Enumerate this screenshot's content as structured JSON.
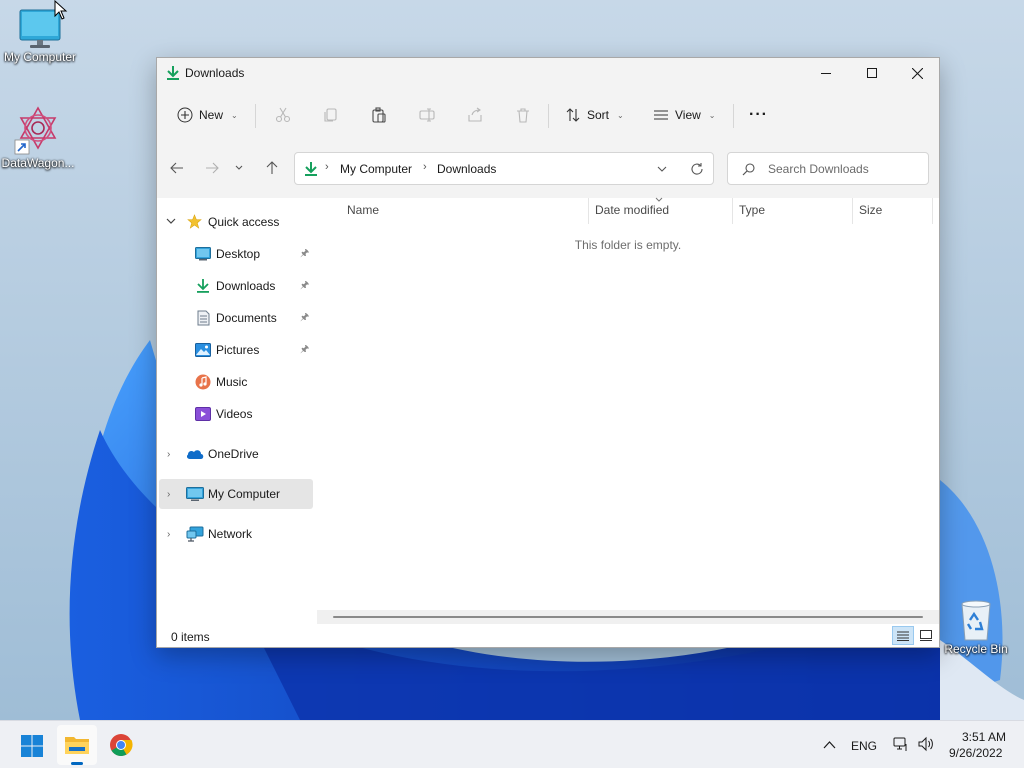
{
  "desktop": {
    "icons": [
      {
        "label": "My Computer",
        "icon": "monitor-icon"
      },
      {
        "label": "DataWagon...",
        "icon": "datawagon-app-icon"
      },
      {
        "label": "Recycle Bin",
        "icon": "recycle-bin-icon"
      }
    ]
  },
  "window": {
    "title": "Downloads",
    "title_icon": "download-arrow-icon",
    "controls": {
      "minimize": "minimize-icon",
      "maximize": "maximize-icon",
      "close": "close-icon"
    }
  },
  "toolbar": {
    "new_label": "New",
    "sort_label": "Sort",
    "view_label": "View",
    "more_label": "···",
    "disabled_icons": [
      "cut-icon",
      "copy-icon",
      "paste-icon",
      "rename-icon",
      "share-icon",
      "delete-icon"
    ]
  },
  "address": {
    "breadcrumb": [
      "My Computer",
      "Downloads"
    ],
    "search_placeholder": "Search Downloads"
  },
  "nav_pane": {
    "quick_access": "Quick access",
    "pinned": [
      {
        "label": "Desktop",
        "icon": "desktop-folder-icon",
        "pinned": true
      },
      {
        "label": "Downloads",
        "icon": "download-arrow-icon",
        "pinned": true
      },
      {
        "label": "Documents",
        "icon": "documents-icon",
        "pinned": true
      },
      {
        "label": "Pictures",
        "icon": "pictures-icon",
        "pinned": true
      },
      {
        "label": "Music",
        "icon": "music-icon",
        "pinned": false
      },
      {
        "label": "Videos",
        "icon": "videos-icon",
        "pinned": false
      }
    ],
    "onedrive": "OneDrive",
    "my_computer": "My Computer",
    "network": "Network"
  },
  "file_list": {
    "columns": [
      "Name",
      "Date modified",
      "Type",
      "Size"
    ],
    "empty_message": "This folder is empty."
  },
  "status": {
    "items_text": "0 items"
  },
  "taskbar": {
    "apps": [
      "start-icon",
      "file-explorer-icon",
      "chrome-icon"
    ],
    "language": "ENG",
    "time": "3:51 AM",
    "date": "9/26/2022"
  },
  "colors": {
    "accent": "#0067c0",
    "download_green": "#16a05d",
    "selected_bg": "#e5e5e5"
  }
}
